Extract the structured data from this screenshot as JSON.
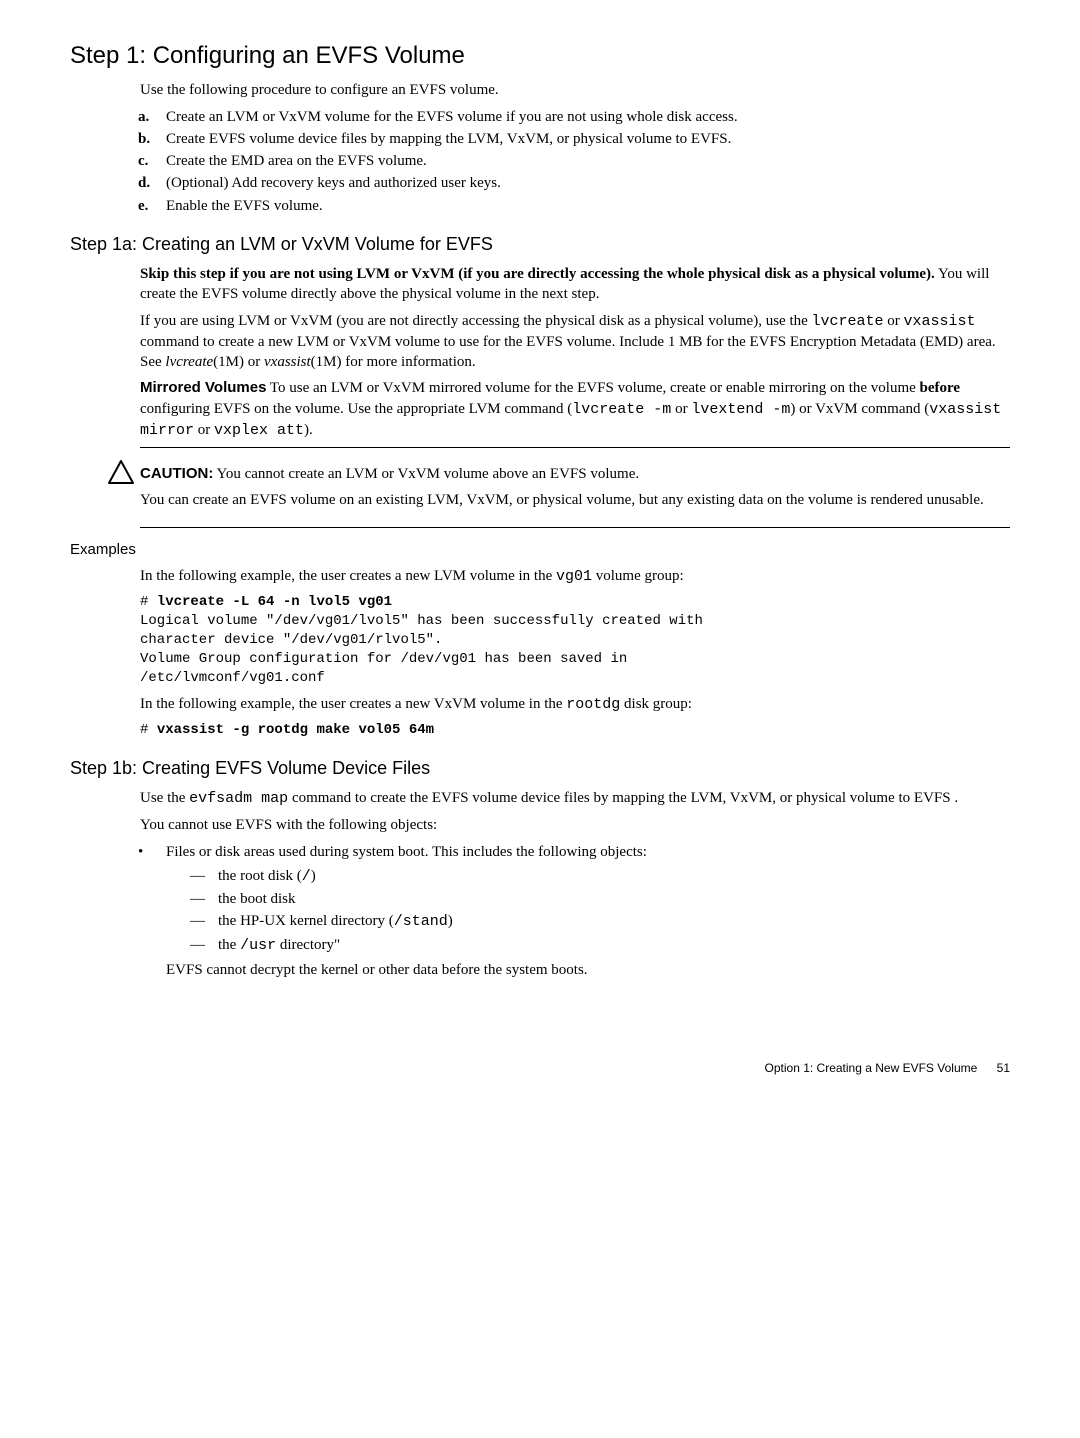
{
  "h2_step1": "Step 1: Configuring an EVFS Volume",
  "p_intro": "Use the following procedure to configure an EVFS volume.",
  "steps": {
    "a_m": "a.",
    "a": "Create an LVM or VxVM volume for the EVFS volume if you are not using whole disk access.",
    "b_m": "b.",
    "b": "Create EVFS volume device files by mapping the LVM, VxVM, or physical volume to EVFS.",
    "c_m": "c.",
    "c": "Create the EMD area on the EVFS volume.",
    "d_m": "d.",
    "d": "(Optional) Add recovery keys and authorized user keys.",
    "e_m": "e.",
    "e": "Enable the EVFS volume."
  },
  "h3_step1a": "Step 1a: Creating an LVM or VxVM Volume for EVFS",
  "s1a": {
    "skip_bold": "Skip this step if you are not using LVM or VxVM (if you are directly accessing the whole physical disk as a physical volume).",
    "skip_rest": " You will create the EVFS volume directly above the physical volume in the next step.",
    "p2a": "If you are using LVM or VxVM (you are not directly accessing the physical disk as a physical volume), use the ",
    "p2_cmd1": "lvcreate",
    "p2b": " or ",
    "p2_cmd2": "vxassist",
    "p2c": " command to create a new LVM or VxVM volume to use for the EVFS volume. Include 1 MB for the EVFS Encryption Metadata (EMD) area. See ",
    "p2_it1": "lvcreate",
    "p2d": "(1M) or ",
    "p2_it2": "vxassist",
    "p2e": "(1M) for more information.",
    "mv_label": "Mirrored Volumes",
    "mv_a": "    To use an LVM or VxVM mirrored volume for the EVFS volume, create or enable mirroring on the volume ",
    "mv_before": "before",
    "mv_b": " configuring  EVFS on the volume. Use the appropriate LVM command (",
    "mv_c1": "lvcreate -m",
    "mv_c": " or ",
    "mv_c2": "lvextend -m",
    "mv_d": ") or VxVM command (",
    "mv_c3": "vxassist mirror",
    "mv_e": " or ",
    "mv_c4": "vxplex att",
    "mv_f": ")."
  },
  "caution": {
    "label": "CAUTION:",
    "p1": "   You cannot create an LVM or VxVM volume above an EVFS volume.",
    "p2": "You can create an EVFS volume on an existing LVM, VxVM, or physical volume, but any existing data on the volume is rendered unusable."
  },
  "h4_examples": "Examples",
  "ex": {
    "p1a": "In the following example, the user creates a new LVM volume in the ",
    "p1_code": "vg01",
    "p1b": " volume group:",
    "code1": "# lvcreate -L 64 -n lvol5 vg01\nLogical volume \"/dev/vg01/lvol5\" has been successfully created with\ncharacter device \"/dev/vg01/rlvol5\".\nVolume Group configuration for /dev/vg01 has been saved in\n/etc/lvmconf/vg01.conf",
    "code1_bold": "lvcreate -L 64 -n lvol5 vg01",
    "p2a": "In the following example, the user creates a new VxVM volume in the ",
    "p2_code": "rootdg",
    "p2b": " disk group:",
    "code2_prefix": "# ",
    "code2_bold": "vxassist -g rootdg make vol05 64m"
  },
  "h3_step1b": "Step 1b: Creating EVFS Volume Device Files",
  "s1b": {
    "p1a": "Use the ",
    "p1_cmd": "evfsadm map",
    "p1b": " command to create the EVFS volume device files by mapping the LVM, VxVM, or physical volume to EVFS .",
    "p2": "You cannot use EVFS with the following objects:",
    "bul1": "Files or disk areas used during system boot. This includes the following objects:",
    "d1a": "the root disk (",
    "d1_code": "/",
    "d1b": ")",
    "d2": "the boot disk",
    "d3a": "the HP-UX kernel directory (",
    "d3_code": "/stand",
    "d3b": ")",
    "d4a": "the ",
    "d4_code": "/usr",
    "d4b": " directory\"",
    "p3": "EVFS cannot decrypt the kernel or other data before the system boots."
  },
  "footer": {
    "text": "Option 1: Creating a New EVFS Volume",
    "page": "51"
  }
}
